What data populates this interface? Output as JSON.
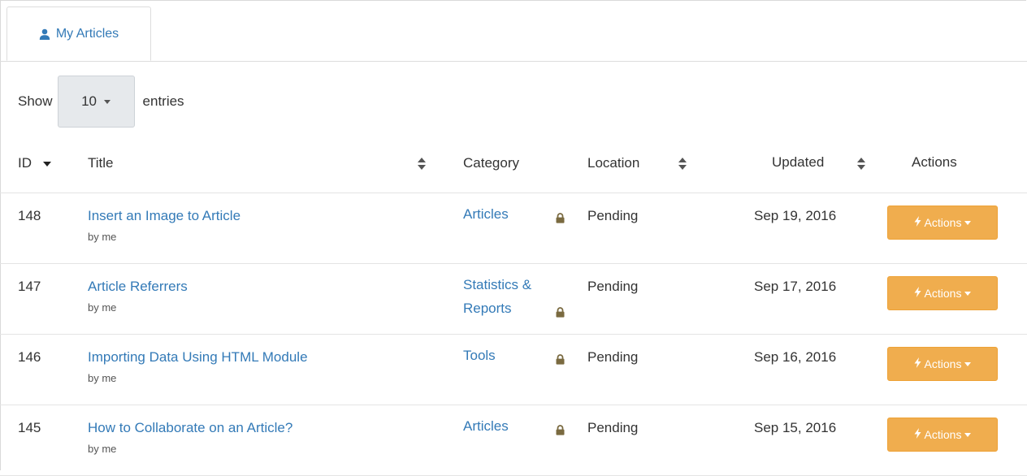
{
  "tabs": [
    {
      "label": "My Articles",
      "icon": "user-icon",
      "active": true
    }
  ],
  "length_control": {
    "prefix": "Show",
    "value": "10",
    "suffix": "entries"
  },
  "columns": {
    "id": "ID",
    "title": "Title",
    "category": "Category",
    "location": "Location",
    "updated": "Updated",
    "actions": "Actions"
  },
  "rows": [
    {
      "id": "148",
      "title": "Insert an Image to Article",
      "by": "by me",
      "category": [
        "Articles"
      ],
      "location": "Pending",
      "updated": "Sep 19, 2016",
      "action": "Actions"
    },
    {
      "id": "147",
      "title": "Article Referrers",
      "by": "by me",
      "category": [
        "Statistics &",
        "Reports"
      ],
      "location": "Pending",
      "updated": "Sep 17, 2016",
      "action": "Actions"
    },
    {
      "id": "146",
      "title": "Importing Data Using HTML Module",
      "by": "by me",
      "category": [
        "Tools"
      ],
      "location": "Pending",
      "updated": "Sep 16, 2016",
      "action": "Actions"
    },
    {
      "id": "145",
      "title": "How to Collaborate on an Article?",
      "by": "by me",
      "category": [
        "Articles"
      ],
      "location": "Pending",
      "updated": "Sep 15, 2016",
      "action": "Actions"
    }
  ],
  "colors": {
    "link": "#337ab7",
    "action_button": "#f0ad4e",
    "select_bg": "#e6e9ec"
  }
}
